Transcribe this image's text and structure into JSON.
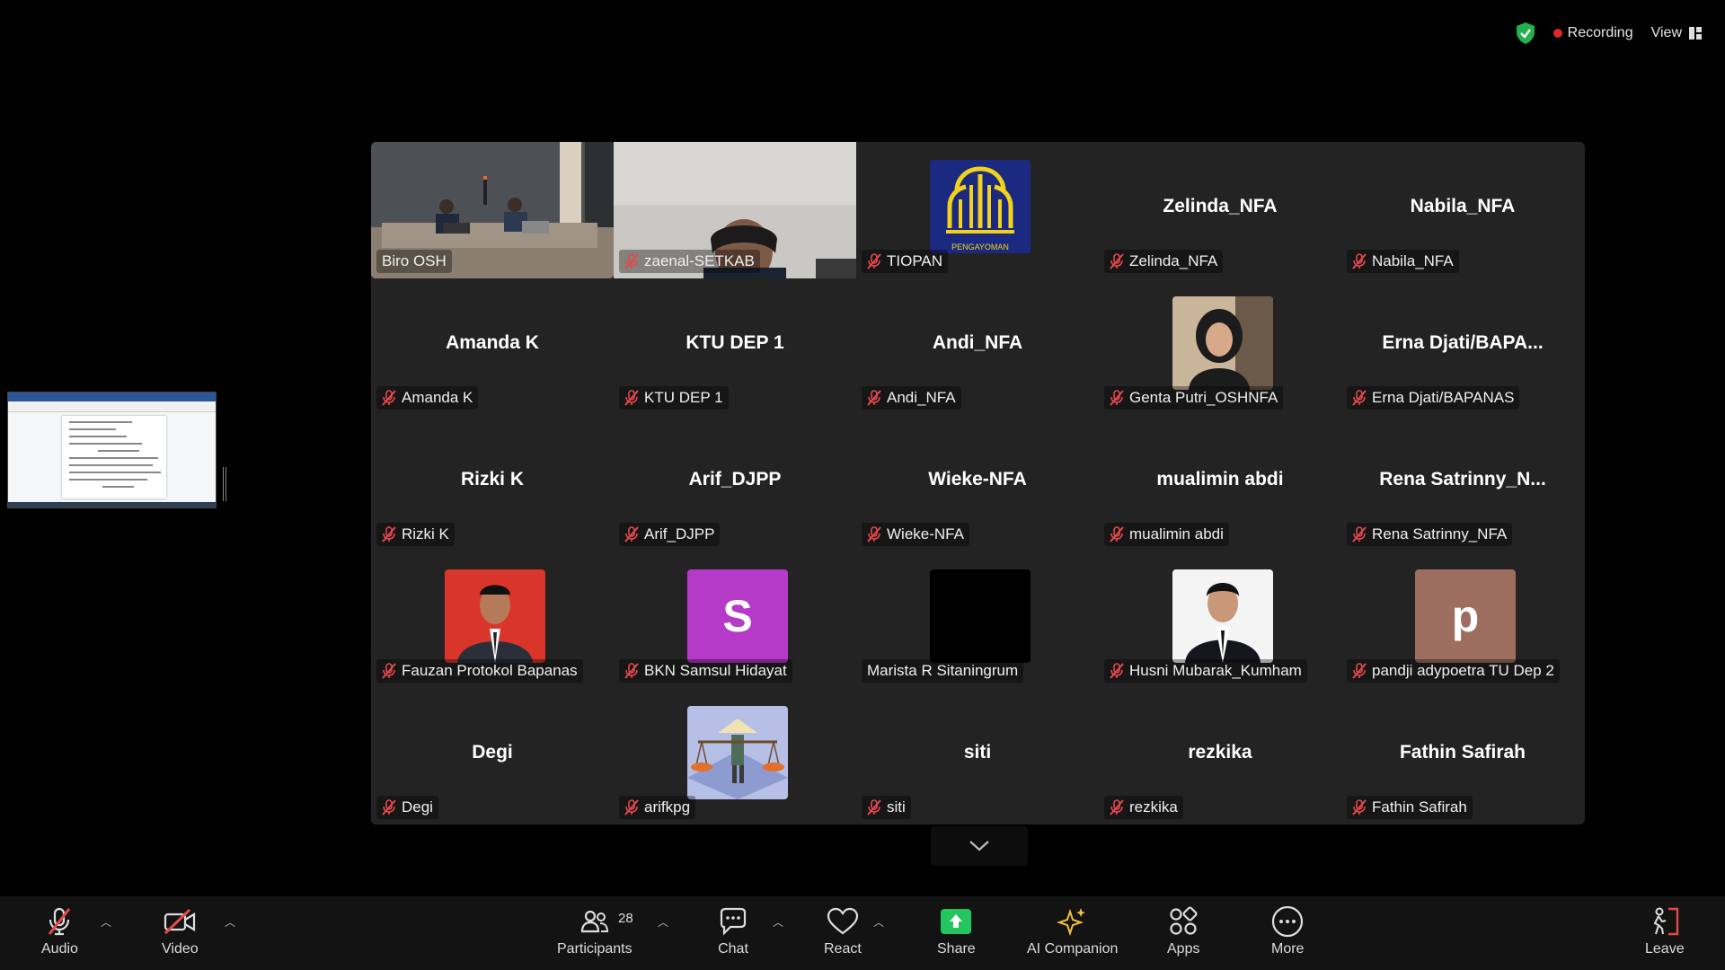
{
  "status": {
    "recording_label": "Recording",
    "view_label": "View"
  },
  "gallery": {
    "tiles": [
      {
        "display": "video",
        "label": "Biro OSH",
        "muted": false,
        "active": true,
        "video": "room"
      },
      {
        "display": "video",
        "label": "zaenal-SETKAB",
        "muted": true,
        "active": false,
        "video": "person"
      },
      {
        "display": "logo",
        "label": "TIOPAN",
        "muted": true,
        "logo_text": "PENGAYOMAN"
      },
      {
        "display": "name",
        "label": "Zelinda_NFA",
        "big": "Zelinda_NFA",
        "muted": true
      },
      {
        "display": "name",
        "label": "Nabila_NFA",
        "big": "Nabila_NFA",
        "muted": true
      },
      {
        "display": "name",
        "label": "Amanda K",
        "big": "Amanda K",
        "muted": true
      },
      {
        "display": "name",
        "label": "KTU DEP 1",
        "big": "KTU DEP 1",
        "muted": true
      },
      {
        "display": "name",
        "label": "Andi_NFA",
        "big": "Andi_NFA",
        "muted": true
      },
      {
        "display": "photo",
        "label": "Genta Putri_OSHNFA",
        "muted": true,
        "photo": "hijab"
      },
      {
        "display": "name",
        "label": "Erna Djati/BAPANAS",
        "big": "Erna  Djati/BAPA...",
        "muted": true
      },
      {
        "display": "name",
        "label": "Rizki K",
        "big": "Rizki K",
        "muted": true
      },
      {
        "display": "name",
        "label": "Arif_DJPP",
        "big": "Arif_DJPP",
        "muted": true
      },
      {
        "display": "name",
        "label": "Wieke-NFA",
        "big": "Wieke-NFA",
        "muted": true
      },
      {
        "display": "name",
        "label": "mualimin abdi",
        "big": "mualimin abdi",
        "muted": true
      },
      {
        "display": "name",
        "label": "Rena Satrinny_NFA",
        "big": "Rena  Satrinny_N...",
        "muted": true
      },
      {
        "display": "photo",
        "label": "Fauzan Protokol Bapanas",
        "muted": true,
        "photo": "formal-red"
      },
      {
        "display": "letter",
        "label": "BKN Samsul Hidayat",
        "muted": true,
        "letter": "S",
        "color": "#b43ac7"
      },
      {
        "display": "photo",
        "label": "Marista R Sitaningrum",
        "muted": false,
        "photo": "black"
      },
      {
        "display": "photo",
        "label": "Husni Mubarak_Kumham",
        "muted": true,
        "photo": "formal-white"
      },
      {
        "display": "letter",
        "label": "pandji adypoetra TU Dep 2",
        "muted": true,
        "letter": "p",
        "color": "#9d6e5f"
      },
      {
        "display": "name",
        "label": "Degi",
        "big": "Degi",
        "muted": true
      },
      {
        "display": "photo",
        "label": "arifkpg",
        "muted": true,
        "photo": "illustration"
      },
      {
        "display": "name",
        "label": "siti",
        "big": "siti",
        "muted": true
      },
      {
        "display": "name",
        "label": "rezkika",
        "big": "rezkika",
        "muted": true
      },
      {
        "display": "name",
        "label": "Fathin Safirah",
        "big": "Fathin Safirah",
        "muted": true
      }
    ]
  },
  "toolbar": {
    "audio_label": "Audio",
    "video_label": "Video",
    "participants_label": "Participants",
    "participants_count": "28",
    "chat_label": "Chat",
    "react_label": "React",
    "share_label": "Share",
    "ai_label": "AI Companion",
    "apps_label": "Apps",
    "more_label": "More",
    "leave_label": "Leave"
  },
  "colors": {
    "active_speaker": "#2fd88b",
    "share_green": "#22c55e",
    "mute_red": "#e5484d",
    "recording_red": "#e02828"
  }
}
